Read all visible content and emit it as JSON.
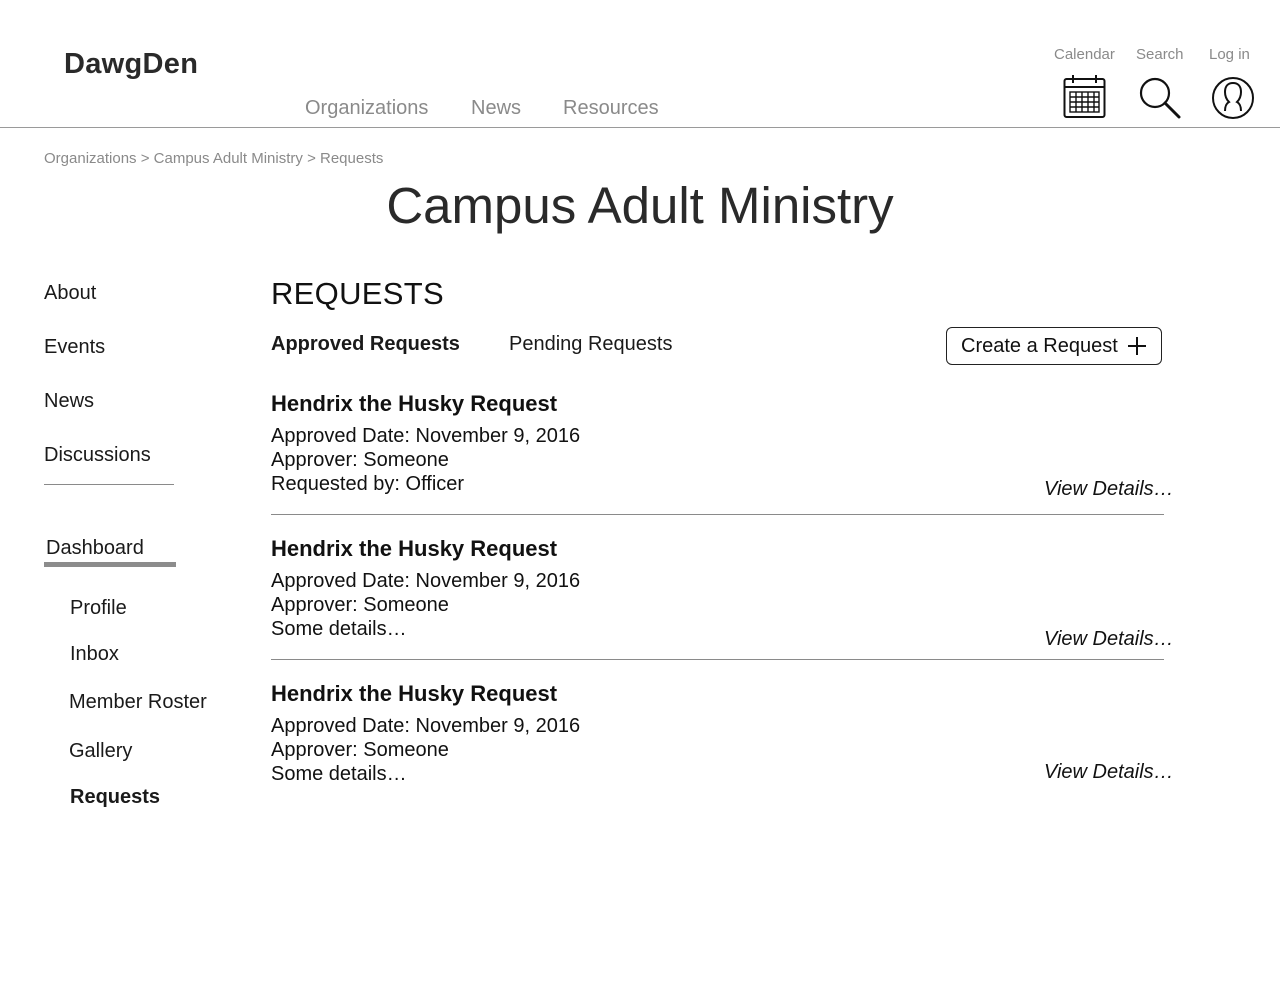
{
  "header": {
    "logo": "DawgDen",
    "nav": [
      "Organizations",
      "News",
      "Resources"
    ],
    "utility": {
      "calendar_label": "Calendar",
      "search_label": "Search",
      "login_label": "Log in",
      "calendar_icon": "calendar-icon",
      "search_icon": "search-icon",
      "login_icon": "user-circle-icon"
    }
  },
  "breadcrumb": [
    "Organizations",
    "Campus Adult Ministry",
    "Requests"
  ],
  "breadcrumb_separator": ">",
  "page_title": "Campus Adult Ministry",
  "sidebar": {
    "items": [
      "About",
      "Events",
      "News",
      "Discussions"
    ],
    "dashboard_label": "Dashboard",
    "sub_items": [
      "Profile",
      "Inbox",
      "Member Roster",
      "Gallery",
      "Requests"
    ],
    "active_sub_item": "Requests"
  },
  "main": {
    "section_title": "REQUESTS",
    "tabs": [
      {
        "label": "Approved Requests",
        "active": true
      },
      {
        "label": "Pending Requests",
        "active": false
      }
    ],
    "create_button_label": "Create a Request",
    "create_button_icon": "plus-icon",
    "requests": [
      {
        "title": "Hendrix the Husky Request",
        "lines": [
          "Approved Date: November 9, 2016",
          "Approver: Someone",
          "Requested by: Officer"
        ],
        "link": "View Details…"
      },
      {
        "title": "Hendrix the Husky Request",
        "lines": [
          "Approved Date: November 9, 2016",
          "Approver: Someone",
          "Some details…"
        ],
        "link": "View Details…"
      },
      {
        "title": "Hendrix the Husky Request",
        "lines": [
          "Approved Date: November 9, 2016",
          "Approver: Someone",
          "Some details…"
        ],
        "link": "View Details…"
      }
    ]
  },
  "colors": {
    "text": "#1a1a1a",
    "muted": "#8a8a8a",
    "rule": "#9a9a9a",
    "active_underline": "#8c8c8c"
  }
}
